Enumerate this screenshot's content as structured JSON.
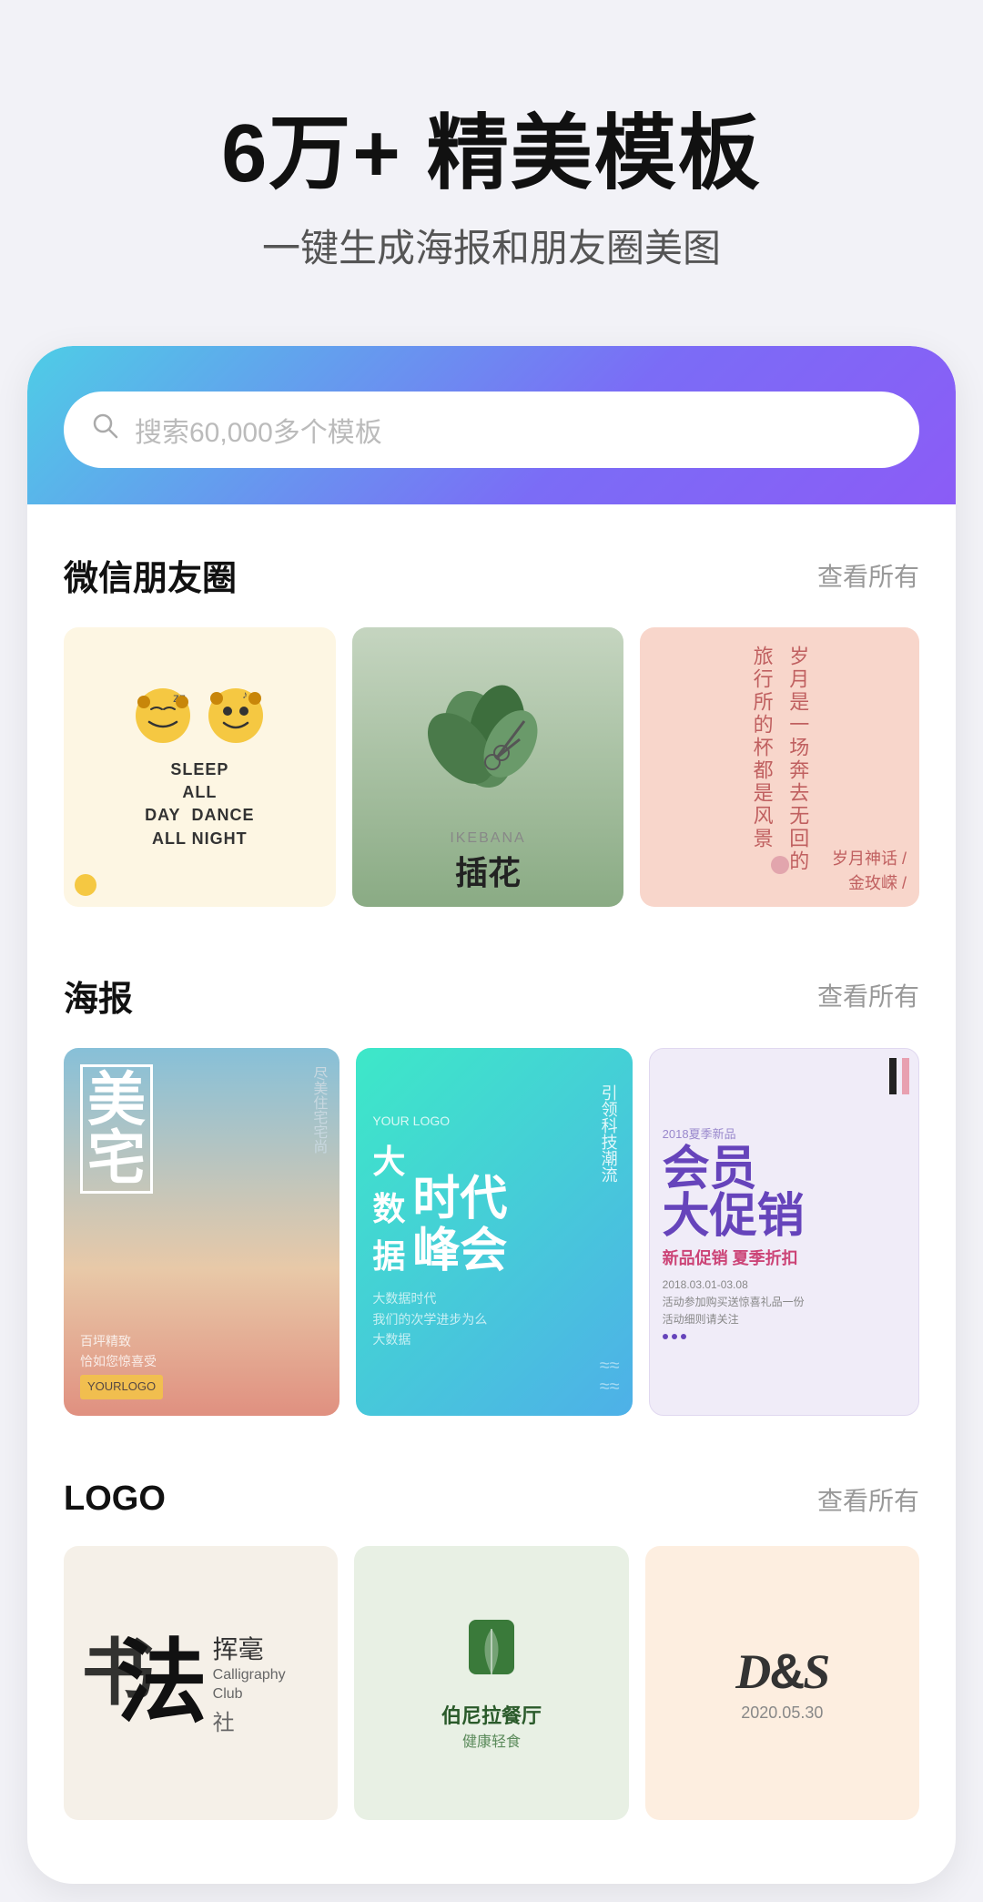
{
  "hero": {
    "title": "6万+ 精美模板",
    "subtitle": "一键生成海报和朋友圈美图"
  },
  "search": {
    "placeholder": "搜索60,000多个模板"
  },
  "sections": {
    "wechat": {
      "title": "微信朋友圈",
      "more": "查看所有",
      "cards": [
        {
          "type": "sleep-dance",
          "line1": "SLEEP ALL DAY",
          "line2": "DANCE ALL NIGHT"
        },
        {
          "type": "ikebana",
          "en": "IKEBANA",
          "cn": "插花"
        },
        {
          "type": "poem",
          "lines": [
            "岁月是一场",
            "奔去无回的旅行",
            "所的杯都是风景"
          ],
          "author": "岁月神话 /",
          "author2": "金玫嵘 /"
        }
      ]
    },
    "poster": {
      "title": "海报",
      "more": "查看所有",
      "cards": [
        {
          "type": "meizhai",
          "title": "美宅",
          "side": "尽美住宅宅尚",
          "body": "百坪精致\n恰如您惊喜受",
          "logo": "YOURLOGO"
        },
        {
          "type": "bigdata",
          "logo": "YOUR LOGO",
          "main1": "时代",
          "main2": "峰会",
          "right": "引领科技潮流",
          "sub": "大数据",
          "body": "大数据时代\n我们的次学进步为么\n大数据"
        },
        {
          "type": "member",
          "label": "2018夏季新品",
          "title": "会员\n大促销",
          "sub": "新品促销 夏季折扣",
          "body": "2018.03.01-03.08\n活动参加购买送惊喜礼品一份\n活动细则请关注"
        }
      ]
    },
    "logo": {
      "title": "LOGO",
      "more": "查看所有",
      "cards": [
        {
          "type": "calligraphy",
          "kanji": "法",
          "kanji2": "书",
          "small_cn": "挥毫",
          "en_line1": "Calligraphy",
          "en_line2": "Club",
          "cn_sub": "社"
        },
        {
          "type": "restaurant",
          "name": "伯尼拉餐厅",
          "sub": "健康轻食"
        },
        {
          "type": "ds",
          "title": "D&S",
          "date": "2020.05.30"
        }
      ]
    }
  }
}
